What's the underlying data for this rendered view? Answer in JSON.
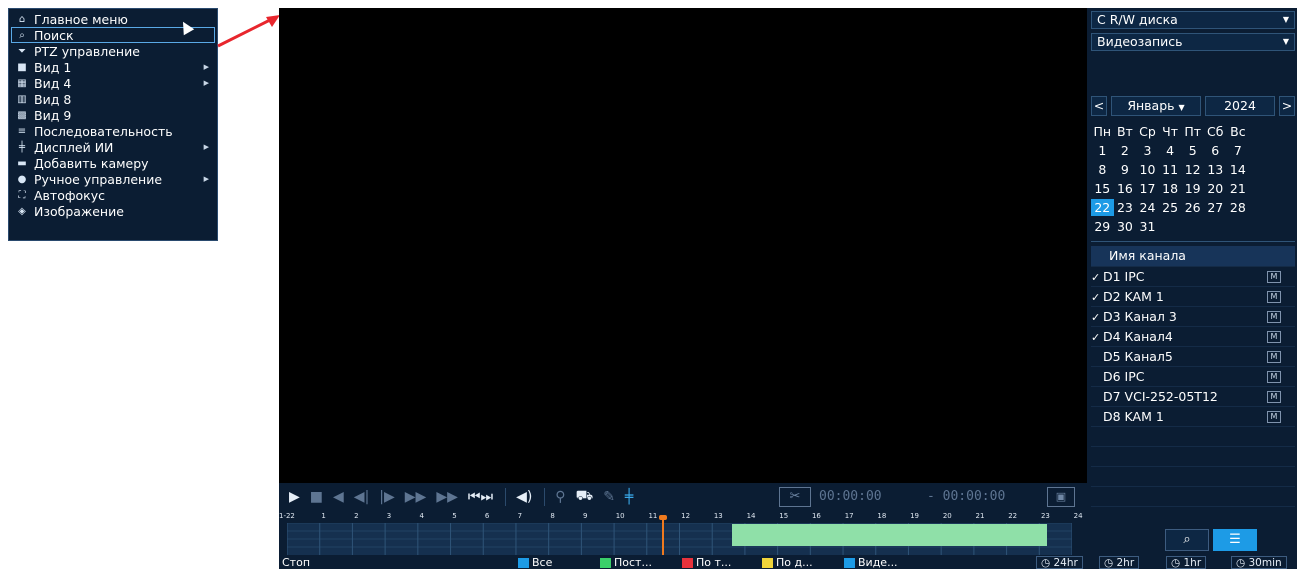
{
  "menu": {
    "items": [
      {
        "icon": "home-icon",
        "glyph": "⌂",
        "label": "Главное меню",
        "submenu": false
      },
      {
        "icon": "search-icon",
        "glyph": "⌕",
        "label": "Поиск",
        "submenu": false,
        "active": true
      },
      {
        "icon": "ptz-icon",
        "glyph": "⏷",
        "label": "PTZ управление",
        "submenu": false
      },
      {
        "icon": "view1-icon",
        "glyph": "■",
        "label": "Вид 1",
        "submenu": true
      },
      {
        "icon": "view4-icon",
        "glyph": "▦",
        "label": "Вид 4",
        "submenu": true
      },
      {
        "icon": "view8-icon",
        "glyph": "▥",
        "label": "Вид 8",
        "submenu": false
      },
      {
        "icon": "view9-icon",
        "glyph": "▩",
        "label": "Вид 9",
        "submenu": false
      },
      {
        "icon": "sequence-icon",
        "glyph": "≡",
        "label": "Последовательность",
        "submenu": false
      },
      {
        "icon": "ai-display-icon",
        "glyph": "╪",
        "label": "Дисплей ИИ",
        "submenu": true
      },
      {
        "icon": "add-camera-icon",
        "glyph": "▬",
        "label": "Добавить камеру",
        "submenu": false
      },
      {
        "icon": "manual-control-icon",
        "glyph": "●",
        "label": "Ручное управление",
        "submenu": true
      },
      {
        "icon": "autofocus-icon",
        "glyph": "⛶",
        "label": "Автофокус",
        "submenu": false
      },
      {
        "icon": "image-icon",
        "glyph": "◈",
        "label": "Изображение",
        "submenu": false
      }
    ]
  },
  "playback": {
    "time_start": "00:00:00",
    "time_sep": "-",
    "time_end": "00:00:00",
    "hours": [
      "1-22",
      "1",
      "2",
      "3",
      "4",
      "5",
      "6",
      "7",
      "8",
      "9",
      "10",
      "11",
      "12",
      "13",
      "14",
      "15",
      "16",
      "17",
      "18",
      "19",
      "20",
      "21",
      "22",
      "23",
      "24"
    ]
  },
  "status": {
    "state": "Стоп",
    "filters": [
      {
        "label": "Все",
        "color": "#1d9be6"
      },
      {
        "label": "Пост...",
        "color": "#3ad06a"
      },
      {
        "label": "По т...",
        "color": "#e8323c"
      },
      {
        "label": "По д...",
        "color": "#f0d43a"
      },
      {
        "label": "Виде...",
        "color": "#1d9be6"
      }
    ],
    "zoom": [
      "24hr",
      "2hr",
      "1hr",
      "30min"
    ]
  },
  "right_panel": {
    "source": "С R/W диска",
    "record_type": "Видеозапись",
    "calendar": {
      "prev": "<",
      "month": "Январь",
      "year": "2024",
      "next": ">",
      "weekdays": [
        "Пн",
        "Вт",
        "Ср",
        "Чт",
        "Пт",
        "Сб",
        "Вс"
      ],
      "weeks": [
        [
          "1",
          "2",
          "3",
          "4",
          "5",
          "6",
          "7"
        ],
        [
          "8",
          "9",
          "10",
          "11",
          "12",
          "13",
          "14"
        ],
        [
          "15",
          "16",
          "17",
          "18",
          "19",
          "20",
          "21"
        ],
        [
          "22",
          "23",
          "24",
          "25",
          "26",
          "27",
          "28"
        ],
        [
          "29",
          "30",
          "31",
          "",
          "",
          "",
          ""
        ]
      ],
      "selected": "22"
    },
    "channel_header": "Имя канала",
    "channels": [
      {
        "name": "D1 IPC",
        "checked": true,
        "badge": "M"
      },
      {
        "name": "D2 KAM 1",
        "checked": true,
        "badge": "M"
      },
      {
        "name": "D3 Канал 3",
        "checked": true,
        "badge": "M"
      },
      {
        "name": "D4 Канал4",
        "checked": true,
        "badge": "M"
      },
      {
        "name": "D5 Канал5",
        "checked": false,
        "badge": "M"
      },
      {
        "name": "D6 IPC",
        "checked": false,
        "badge": "M"
      },
      {
        "name": "D7 VCI-252-05T12",
        "checked": false,
        "badge": "M"
      },
      {
        "name": "D8 KAM 1",
        "checked": false,
        "badge": "M"
      }
    ]
  }
}
